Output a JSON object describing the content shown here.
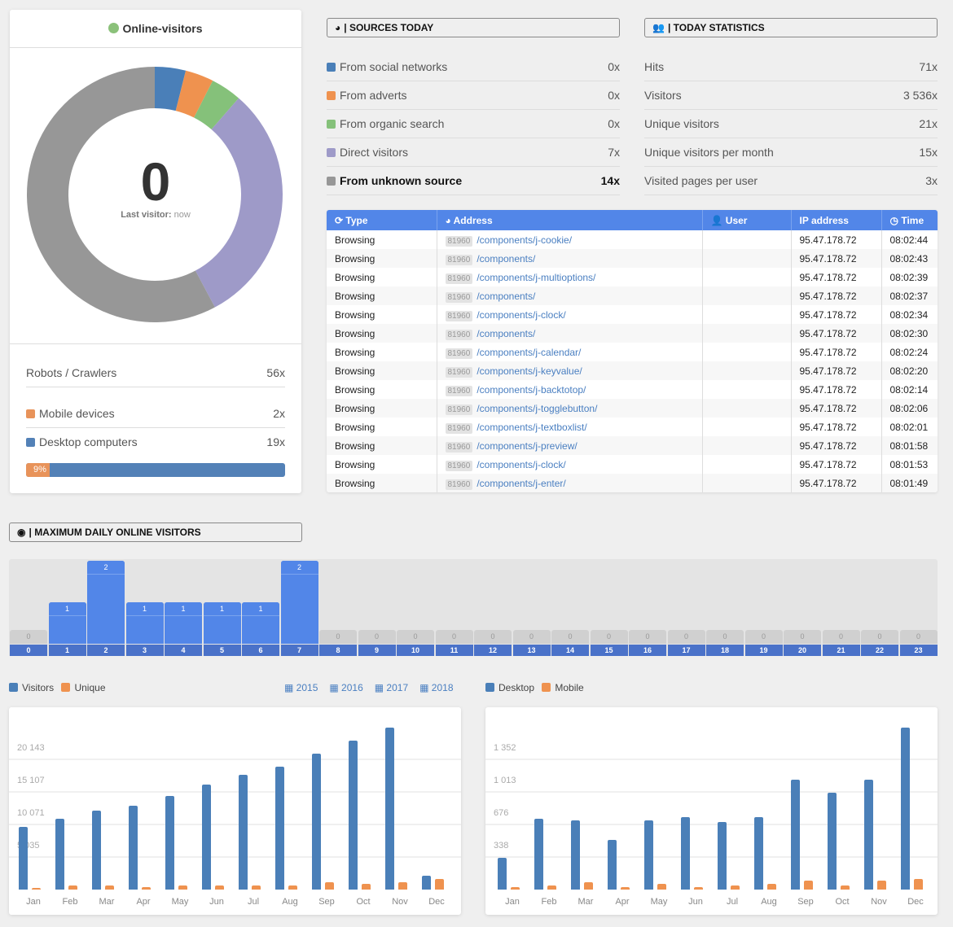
{
  "online": {
    "title": "Online-visitors",
    "count": "0",
    "last_label": "Last visitor:",
    "last_value": "now",
    "status_color": "#8bc17a",
    "donut": [
      {
        "color": "#4a7fb8",
        "fraction": 0.039
      },
      {
        "color": "#ef924f",
        "fraction": 0.036
      },
      {
        "color": "#85c17a",
        "fraction": 0.039
      },
      {
        "color": "#9e9ac8",
        "fraction": 0.308
      },
      {
        "color": "#979797",
        "fraction": 0.578
      }
    ]
  },
  "devices": {
    "robots_label": "Robots / Crawlers",
    "robots_value": "56x",
    "mobile_label": "Mobile devices",
    "mobile_value": "2x",
    "desktop_label": "Desktop computers",
    "desktop_value": "19x",
    "mobile_percent_label": "9%",
    "mobile_percent": 9
  },
  "sources": {
    "title": "SOURCES TODAY",
    "items": [
      {
        "label": "From social networks",
        "value": "0x",
        "color": "#4a7fb8"
      },
      {
        "label": "From adverts",
        "value": "0x",
        "color": "#ef924f"
      },
      {
        "label": "From organic search",
        "value": "0x",
        "color": "#85c17a"
      },
      {
        "label": "Direct visitors",
        "value": "7x",
        "color": "#9e9ac8"
      },
      {
        "label": "From unknown source",
        "value": "14x",
        "color": "#979797"
      }
    ]
  },
  "stats": {
    "title": "TODAY STATISTICS",
    "items": [
      {
        "label": "Hits",
        "value": "71x"
      },
      {
        "label": "Visitors",
        "value": "3 536x"
      },
      {
        "label": "Unique visitors",
        "value": "21x"
      },
      {
        "label": "Unique visitors per month",
        "value": "15x"
      },
      {
        "label": "Visited pages per user",
        "value": "3x"
      }
    ]
  },
  "log": {
    "headers": [
      "Type",
      "Address",
      "User",
      "IP address",
      "Time"
    ],
    "rows": [
      {
        "type": "Browsing",
        "id": "81960",
        "url": "/components/j-cookie/",
        "user": "",
        "ip": "95.47.178.72",
        "time": "08:02:44"
      },
      {
        "type": "Browsing",
        "id": "81960",
        "url": "/components/",
        "user": "",
        "ip": "95.47.178.72",
        "time": "08:02:43"
      },
      {
        "type": "Browsing",
        "id": "81960",
        "url": "/components/j-multioptions/",
        "user": "",
        "ip": "95.47.178.72",
        "time": "08:02:39"
      },
      {
        "type": "Browsing",
        "id": "81960",
        "url": "/components/",
        "user": "",
        "ip": "95.47.178.72",
        "time": "08:02:37"
      },
      {
        "type": "Browsing",
        "id": "81960",
        "url": "/components/j-clock/",
        "user": "",
        "ip": "95.47.178.72",
        "time": "08:02:34"
      },
      {
        "type": "Browsing",
        "id": "81960",
        "url": "/components/",
        "user": "",
        "ip": "95.47.178.72",
        "time": "08:02:30"
      },
      {
        "type": "Browsing",
        "id": "81960",
        "url": "/components/j-calendar/",
        "user": "",
        "ip": "95.47.178.72",
        "time": "08:02:24"
      },
      {
        "type": "Browsing",
        "id": "81960",
        "url": "/components/j-keyvalue/",
        "user": "",
        "ip": "95.47.178.72",
        "time": "08:02:20"
      },
      {
        "type": "Browsing",
        "id": "81960",
        "url": "/components/j-backtotop/",
        "user": "",
        "ip": "95.47.178.72",
        "time": "08:02:14"
      },
      {
        "type": "Browsing",
        "id": "81960",
        "url": "/components/j-togglebutton/",
        "user": "",
        "ip": "95.47.178.72",
        "time": "08:02:06"
      },
      {
        "type": "Browsing",
        "id": "81960",
        "url": "/components/j-textboxlist/",
        "user": "",
        "ip": "95.47.178.72",
        "time": "08:02:01"
      },
      {
        "type": "Browsing",
        "id": "81960",
        "url": "/components/j-preview/",
        "user": "",
        "ip": "95.47.178.72",
        "time": "08:01:58"
      },
      {
        "type": "Browsing",
        "id": "81960",
        "url": "/components/j-clock/",
        "user": "",
        "ip": "95.47.178.72",
        "time": "08:01:53"
      },
      {
        "type": "Browsing",
        "id": "81960",
        "url": "/components/j-enter/",
        "user": "",
        "ip": "95.47.178.72",
        "time": "08:01:49"
      }
    ]
  },
  "daily": {
    "title": "MAXIMUM DAILY ONLINE VISITORS",
    "hours": [
      "0",
      "1",
      "2",
      "3",
      "4",
      "5",
      "6",
      "7",
      "8",
      "9",
      "10",
      "11",
      "12",
      "13",
      "14",
      "15",
      "16",
      "17",
      "18",
      "19",
      "20",
      "21",
      "22",
      "23"
    ],
    "values": [
      0,
      1,
      2,
      1,
      1,
      1,
      1,
      2,
      0,
      0,
      0,
      0,
      0,
      0,
      0,
      0,
      0,
      0,
      0,
      0,
      0,
      0,
      0,
      0
    ]
  },
  "legend_left": {
    "visitors": "Visitors",
    "unique": "Unique"
  },
  "years": [
    "2015",
    "2016",
    "2017",
    "2018"
  ],
  "legend_right": {
    "desktop": "Desktop",
    "mobile": "Mobile"
  },
  "chart_data": [
    {
      "type": "bar",
      "categories": [
        "Jan",
        "Feb",
        "Mar",
        "Apr",
        "May",
        "Jun",
        "Jul",
        "Aug",
        "Sep",
        "Oct",
        "Nov",
        "Dec"
      ],
      "yticks": [
        "5 035",
        "10 071",
        "15 107",
        "20 143"
      ],
      "ytick_values": [
        5035,
        10071,
        15107,
        20143
      ],
      "grid": true,
      "series": [
        {
          "name": "Visitors",
          "color": "#4a7fb8",
          "values": [
            9690,
            10950,
            12210,
            12970,
            14480,
            16240,
            17750,
            19010,
            21020,
            23040,
            25050,
            2140
          ]
        },
        {
          "name": "Unique",
          "color": "#ef924f",
          "values": [
            130,
            630,
            630,
            380,
            630,
            630,
            630,
            630,
            1130,
            880,
            1130,
            1640
          ]
        }
      ]
    },
    {
      "type": "bar",
      "categories": [
        "Jan",
        "Feb",
        "Mar",
        "Apr",
        "May",
        "Jun",
        "Jul",
        "Aug",
        "Sep",
        "Oct",
        "Nov",
        "Dec"
      ],
      "yticks": [
        "338",
        "676",
        "1 013",
        "1 352"
      ],
      "ytick_values": [
        338,
        676,
        1013,
        1352
      ],
      "grid": true,
      "series": [
        {
          "name": "Desktop",
          "color": "#4a7fb8",
          "values": [
            330,
            735,
            718,
            515,
            718,
            752,
            701,
            752,
            1141,
            1006,
            1141,
            1682
          ]
        },
        {
          "name": "Mobile",
          "color": "#ef924f",
          "values": [
            25,
            42,
            76,
            25,
            59,
            25,
            42,
            59,
            93,
            42,
            93,
            110
          ]
        }
      ]
    }
  ]
}
